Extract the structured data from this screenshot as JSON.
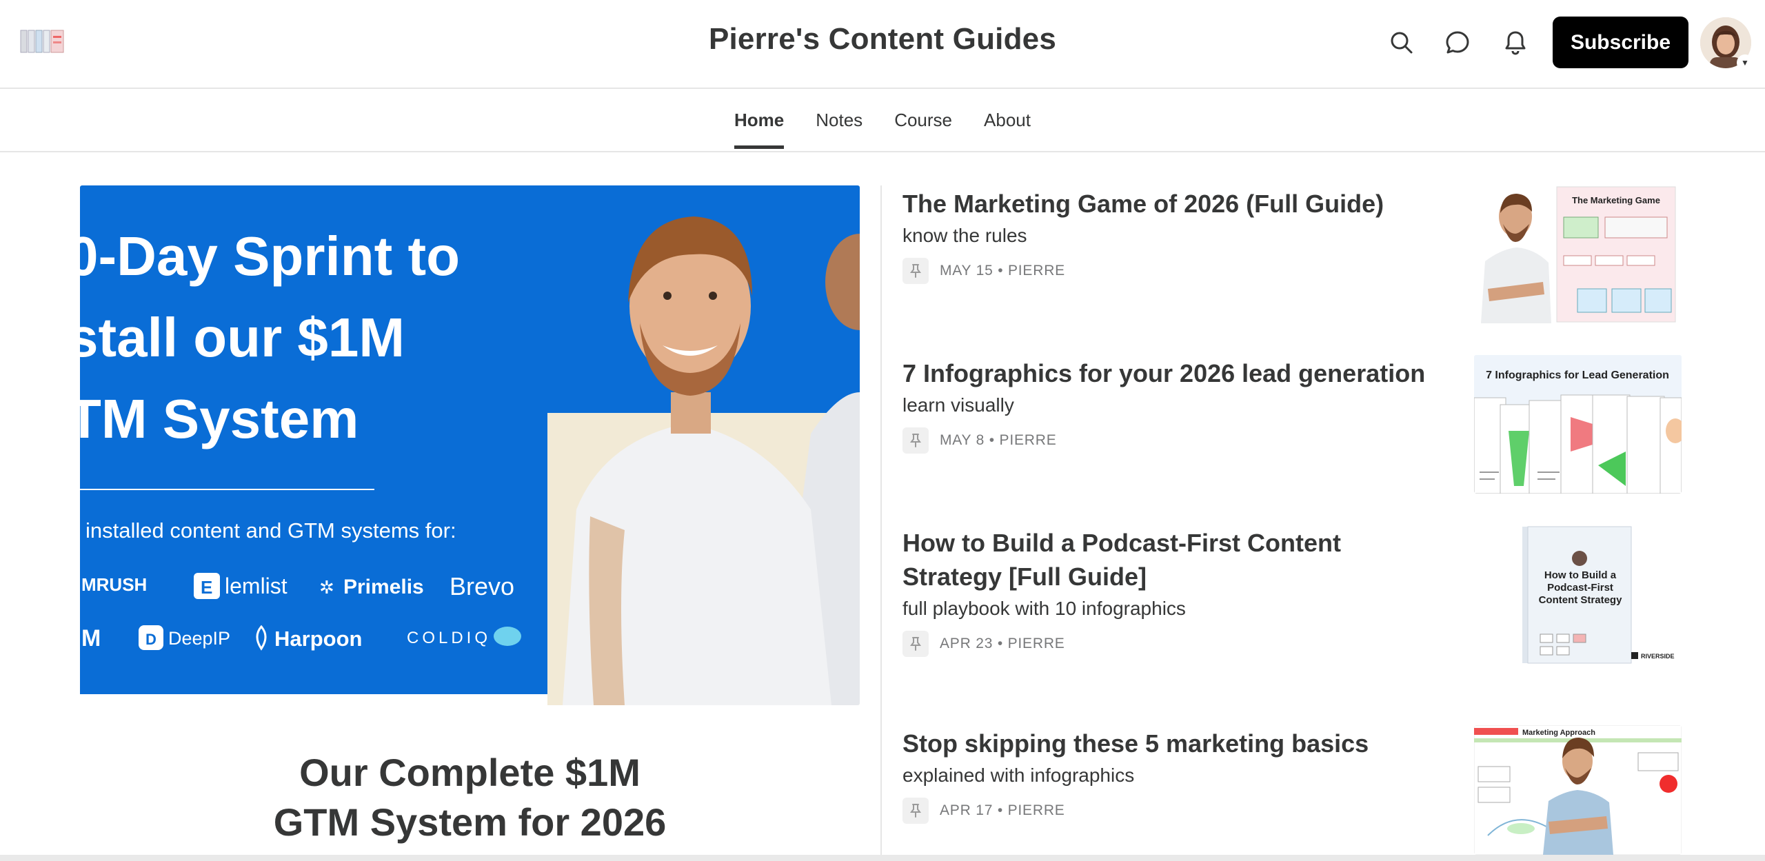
{
  "header": {
    "site_title": "Pierre's Content Guides",
    "subscribe_label": "Subscribe",
    "icons": [
      "search-icon",
      "chat-icon",
      "bell-icon"
    ]
  },
  "nav": {
    "tabs": [
      {
        "label": "Home",
        "active": true
      },
      {
        "label": "Notes",
        "active": false
      },
      {
        "label": "Course",
        "active": false
      },
      {
        "label": "About",
        "active": false
      }
    ]
  },
  "featured": {
    "image_lines": [
      "0-Day Sprint to",
      "stall our $1M",
      "TM System"
    ],
    "image_caption": "installed content and GTM systems for:",
    "logos_row1": [
      "MRUSH",
      "lemlist",
      "Primelis",
      "Brevo"
    ],
    "logos_row2": [
      "M",
      "DeepIP",
      "Harpoon",
      "COLDIQ"
    ],
    "title_line1": "Our Complete $1M",
    "title_line2": "GTM System for 2026",
    "accent_color": "#0a6dd6"
  },
  "posts": [
    {
      "title": "The Marketing Game of 2026 (Full Guide)",
      "subtitle": "know the rules",
      "date": "MAY 15",
      "author": "PIERRE",
      "thumb_title": "The Marketing Game"
    },
    {
      "title": "7 Infographics for your 2026 lead generation",
      "subtitle": "learn visually",
      "date": "MAY 8",
      "author": "PIERRE",
      "thumb_title": "7 Infographics for Lead Generation"
    },
    {
      "title": "How to Build a Podcast-First Content Strategy [Full Guide]",
      "subtitle": "full playbook with 10 infographics",
      "date": "APR 23",
      "author": "PIERRE",
      "thumb_title": "How to Build a Podcast-First Content Strategy",
      "thumb_badge": "RIVERSIDE"
    },
    {
      "title": "Stop skipping these 5 marketing basics",
      "subtitle": "explained with infographics",
      "date": "APR 17",
      "author": "PIERRE",
      "thumb_title": "Marketing Approach"
    }
  ]
}
